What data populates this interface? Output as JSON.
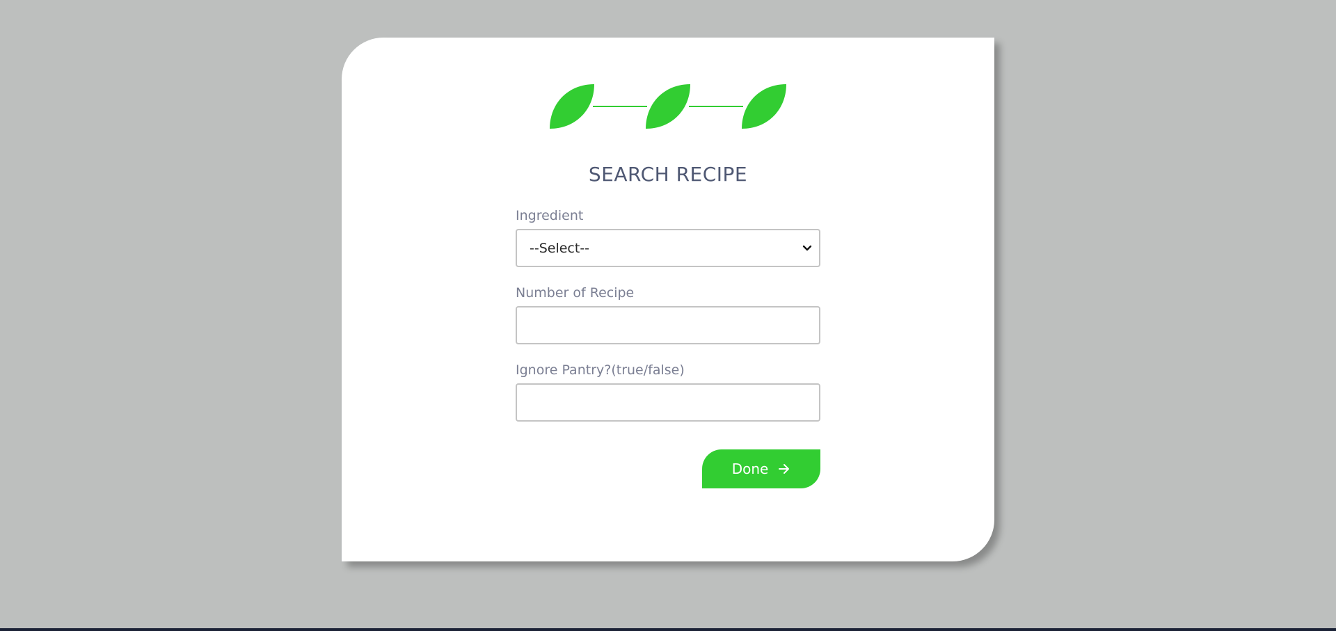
{
  "form": {
    "title": "SEARCH RECIPE",
    "ingredient_label": "Ingredient",
    "ingredient_selected": "--Select--",
    "number_label": "Number of Recipe",
    "number_value": "",
    "pantry_label": "Ignore Pantry?(true/false)",
    "pantry_value": "",
    "submit_label": "Done"
  },
  "steps": {
    "count": 3
  },
  "colors": {
    "accent": "#32cd32",
    "background": "#bdbfbe",
    "card": "#ffffff",
    "title": "#4f5873",
    "label": "#7b7f93",
    "bottom_bar": "#1b2236"
  },
  "icons": {
    "step_marker": "leaf-icon",
    "submit": "arrow-right-icon",
    "select": "chevron-down-icon"
  }
}
